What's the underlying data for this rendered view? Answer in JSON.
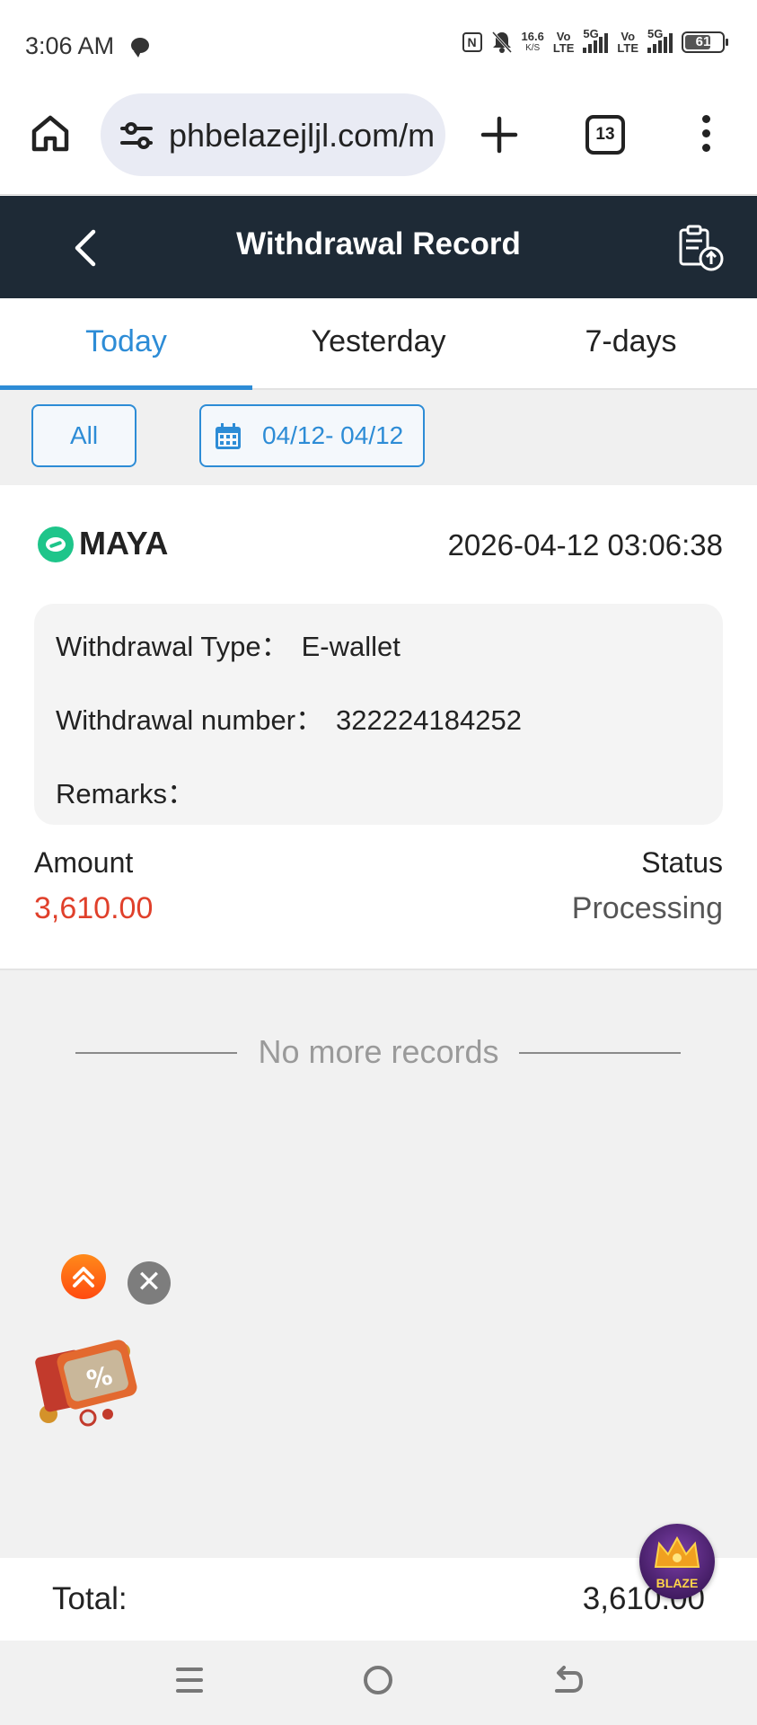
{
  "status_bar": {
    "time": "3:06 AM",
    "net_speed_value": "16.6",
    "net_speed_unit": "K/S",
    "sim1_label_top": "Vo",
    "sim1_label_bottom": "LTE",
    "sim1_tech": "5G",
    "sim2_label_top": "Vo",
    "sim2_label_bottom": "LTE",
    "sim2_tech": "5G",
    "nfc_label": "N",
    "battery": "61"
  },
  "browser": {
    "url": "phbelazejljl.com/m",
    "tab_count": "13"
  },
  "header": {
    "title": "Withdrawal Record"
  },
  "tabs": [
    {
      "label": "Today",
      "active": true
    },
    {
      "label": "Yesterday",
      "active": false
    },
    {
      "label": "7-days",
      "active": false
    }
  ],
  "filters": {
    "type_label": "All",
    "date_range": "04/12- 04/12"
  },
  "record": {
    "method": "MAYA",
    "datetime": "2026-04-12 03:06:38",
    "type_label": "Withdrawal Type：",
    "type_value": "E-wallet",
    "number_label": "Withdrawal number：",
    "number_value": "322224184252",
    "remarks_label": "Remarks：",
    "remarks_value": "",
    "amount_label": "Amount",
    "amount_value": "3,610.00",
    "status_label": "Status",
    "status_value": "Processing"
  },
  "no_more_text": "No more records",
  "close_glyph": "✕",
  "blaze_text": "BLAZE",
  "footer": {
    "total_label": "Total:",
    "total_value": "3,610.00"
  },
  "colors": {
    "accent": "#2d8cd6",
    "header_bg": "#1e2a36",
    "amount": "#e0402b",
    "maya_green": "#1ec58a"
  }
}
